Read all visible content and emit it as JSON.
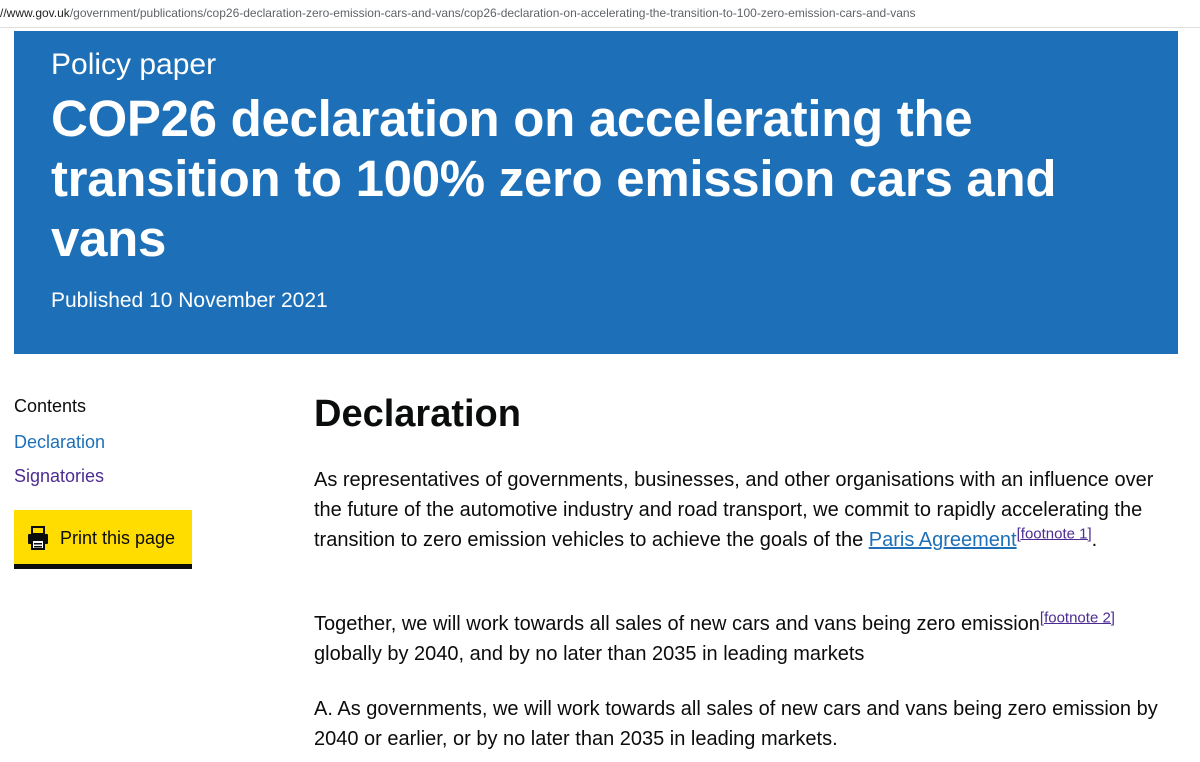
{
  "url": {
    "host": "//www.gov.uk",
    "path": "/government/publications/cop26-declaration-zero-emission-cars-and-vans/cop26-declaration-on-accelerating-the-transition-to-100-zero-emission-cars-and-vans"
  },
  "header": {
    "caption": "Policy paper",
    "title": "COP26 declaration on accelerating the transition to 100% zero emission cars and vans",
    "published": "Published 10 November 2021",
    "background_color": "#1d70b8"
  },
  "sidebar": {
    "contents_label": "Contents",
    "items": [
      {
        "label": "Declaration",
        "color": "#1d70b8"
      },
      {
        "label": "Signatories",
        "color": "#4c2c92"
      }
    ],
    "print_button": {
      "label": "Print this page",
      "icon": "printer-icon",
      "background_color": "#ffdd00"
    }
  },
  "main": {
    "heading": "Declaration",
    "paragraphs": [
      {
        "text_before": "As representatives of governments, businesses, and other organisations with an influence over the future of the automotive industry and road transport, we commit to rapidly accelerating the transition to zero emission vehicles to achieve the goals of the ",
        "link": "Paris Agreement",
        "footnote": "[footnote 1]",
        "text_after": "."
      },
      {
        "text_before": "Together, we will work towards all sales of new cars and vans being zero emission",
        "footnote": "[footnote 2]",
        "text_after": " globally by 2040, and by no later than 2035 in leading markets"
      },
      {
        "text": "A. As governments, we will work towards all sales of new cars and vans being zero emission by 2040 or earlier, or by no later than 2035 in leading markets."
      }
    ]
  }
}
